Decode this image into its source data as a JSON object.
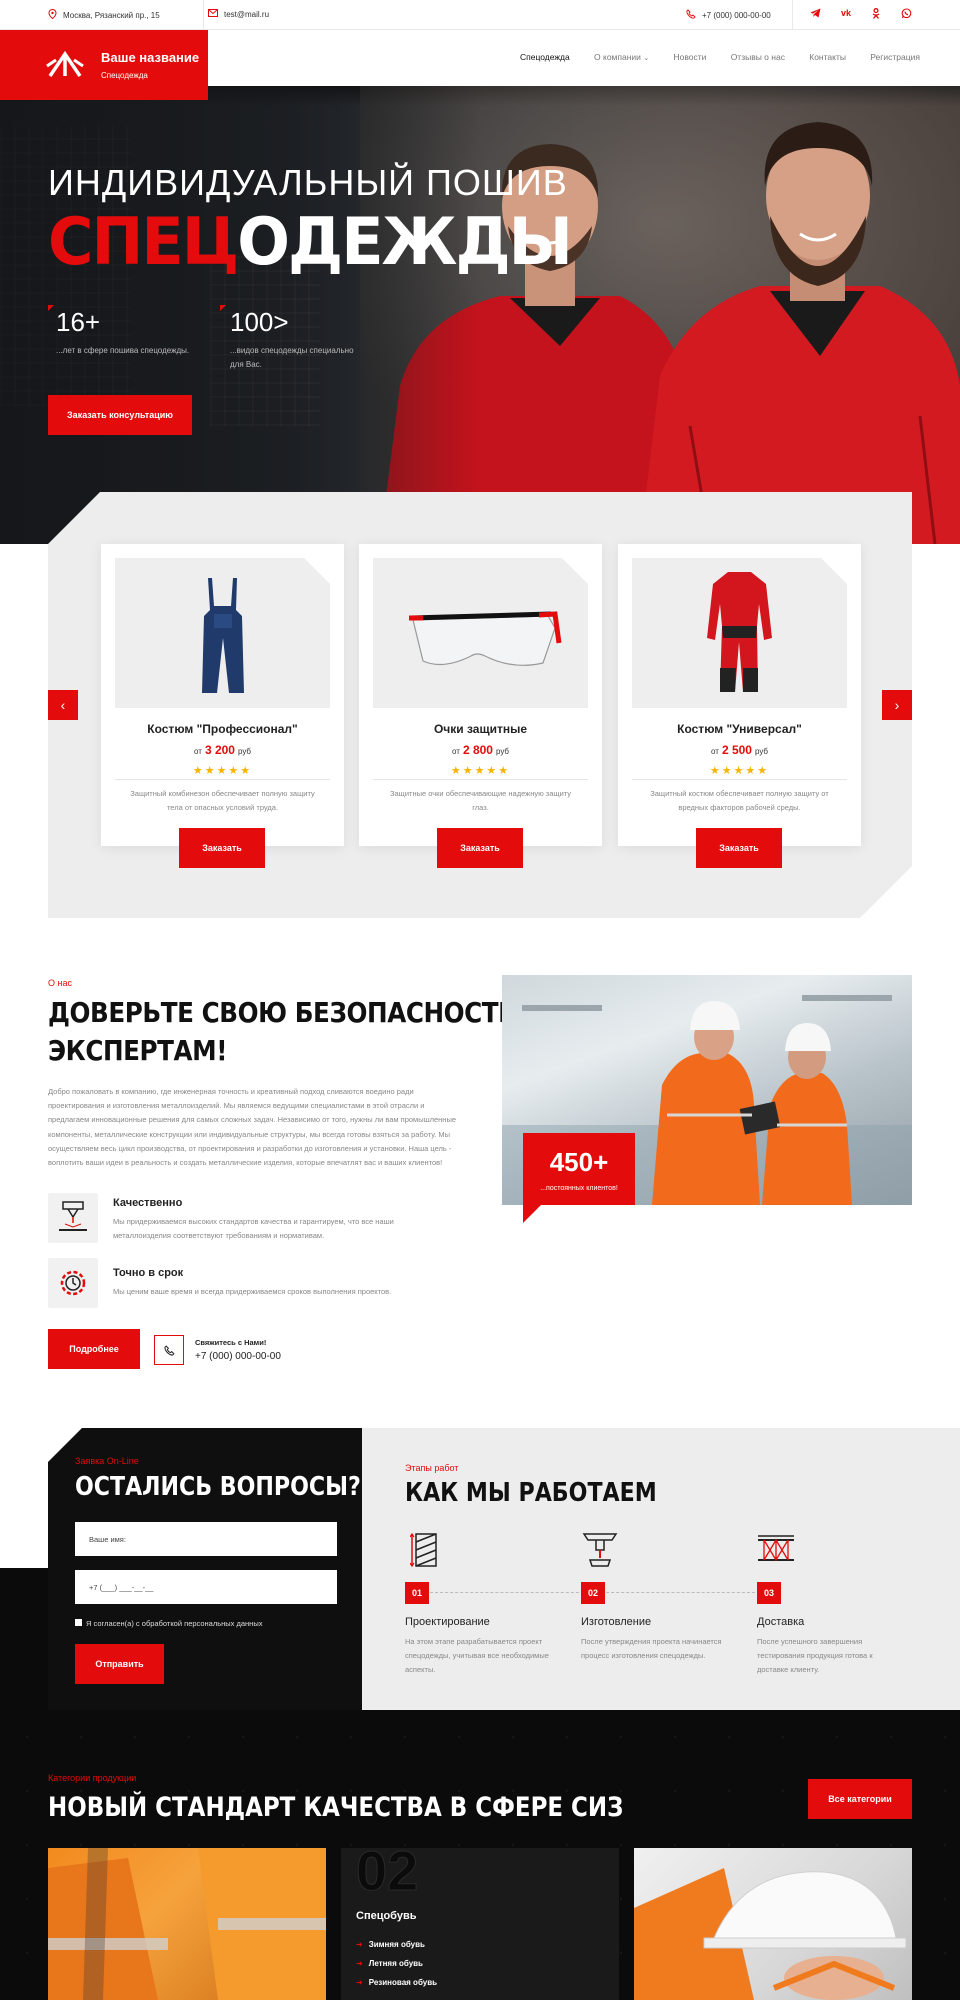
{
  "topbar": {
    "address": "Москва, Рязанский пр., 15",
    "email": "test@mail.ru",
    "phone": "+7 (000) 000-00-00",
    "social": [
      "telegram-icon",
      "vk-icon",
      "odnoklassniki-icon",
      "whatsapp-icon"
    ]
  },
  "header": {
    "logo_title": "Ваше название",
    "logo_subtitle": "Спецодежда",
    "nav": [
      "Спецодежда",
      "О компании",
      "Новости",
      "Отзывы о нас",
      "Контакты",
      "Регистрация"
    ]
  },
  "hero": {
    "title_line1": "ИНДИВИДУАЛЬНЫЙ ПОШИВ",
    "title_red": "СПЕЦ",
    "title_white": "ОДЕЖДЫ",
    "stats": [
      {
        "num": "16+",
        "text": "...лет в сфере пошива спецодежды."
      },
      {
        "num": "100>",
        "text_line1": "...видов спецодежды специально",
        "text_line2": "для Вас."
      }
    ],
    "cta": "Заказать консультацию"
  },
  "products": [
    {
      "name": "Костюм \"Профессионал\"",
      "price_prefix": "от",
      "price": "3 200",
      "currency": "руб",
      "stars": "★★★★★",
      "desc": "Защитный комбинезон обеспечивает полную защиту тела от опасных условий труда.",
      "button": "Заказать"
    },
    {
      "name": "Очки защитные",
      "price_prefix": "от",
      "price": "2 800",
      "currency": "руб",
      "stars": "★★★★★",
      "desc": "Защитные очки обеспечивающие надежную защиту глаз.",
      "button": "Заказать"
    },
    {
      "name": "Костюм \"Универсал\"",
      "price_prefix": "от",
      "price": "2 500",
      "currency": "руб",
      "stars": "★★★★★",
      "desc": "Защитный костюм обеспечивает полную защиту от вредных факторов рабочей среды.",
      "button": "Заказать"
    }
  ],
  "about": {
    "label": "О нас",
    "title_line1": "ДОВЕРЬТЕ СВОЮ БЕЗОПАСНОСТЬ",
    "title_line2": "ЭКСПЕРТАМ!",
    "text": "Добро пожаловать в компанию, где инженерная точность и креативный подход сливаются воедино ради проектирования и изготовления металлоизделий. Мы являемся ведущими специалистами в этой отрасли и предлагаем инновационные решения для самых сложных задач. Независимо от того, нужны ли вам промышленные компоненты, металлические конструкции или индивидуальные структуры, мы всегда готовы взяться за работу. Мы осуществляем весь цикл производства, от проектирования и разработки до изготовления и установки. Наша цель - воплотить ваши идеи в реальность и создать металлические изделия, которые впечатлят вас и ваших клиентов!",
    "features": [
      {
        "title": "Качественно",
        "text": "Мы придерживаемся высоких стандартов качества и гарантируем, что все наши металлоизделия соответствуют требованиям и нормативам."
      },
      {
        "title": "Точно в срок",
        "text": "Мы ценим ваше время и всегда придерживаемся сроков выполнения проектов."
      }
    ],
    "more_button": "Подробнее",
    "contact_label": "Свяжитесь с Нами!",
    "contact_phone": "+7 (000) 000-00-00",
    "badge_num": "450+",
    "badge_text": "...постоянных клиентов!"
  },
  "form": {
    "label": "Заявка On-Line",
    "title": "ОСТАЛИСЬ ВОПРОСЫ?",
    "name_placeholder": "Ваше имя:",
    "phone_placeholder": "+7 (___) ___-__-__",
    "consent": "Я согласен(а) с обработкой персональных данных",
    "submit": "Отправить"
  },
  "steps": {
    "label": "Этапы работ",
    "title": "КАК МЫ РАБОТАЕМ",
    "items": [
      {
        "num": "01",
        "title": "Проектирование",
        "text": "На этом этапе разрабатывается проект спецодежды, учитывая все необходимые аспекты.",
        "icon": "ruler-icon"
      },
      {
        "num": "02",
        "title": "Изготовление",
        "text": "После утверждения проекта начинается процесс изготовления спецодежды.",
        "icon": "press-icon"
      },
      {
        "num": "03",
        "title": "Доставка",
        "text": "После успешного завершения тестирования продукция готова к доставке клиенту.",
        "icon": "truss-icon"
      }
    ]
  },
  "categories": {
    "label": "Категории продукции",
    "title": "НОВЫЙ СТАНДАРТ КАЧЕСТВА В СФЕРЕ СИЗ",
    "all_button": "Все категории",
    "middle": {
      "num": "02",
      "title": "Спецобувь",
      "items": [
        "Зимняя обувь",
        "Летняя обувь",
        "Резиновая обувь"
      ]
    }
  },
  "colors": {
    "accent": "#e30b0b",
    "dark": "#0b0b0b",
    "light_bg": "#ededed"
  }
}
